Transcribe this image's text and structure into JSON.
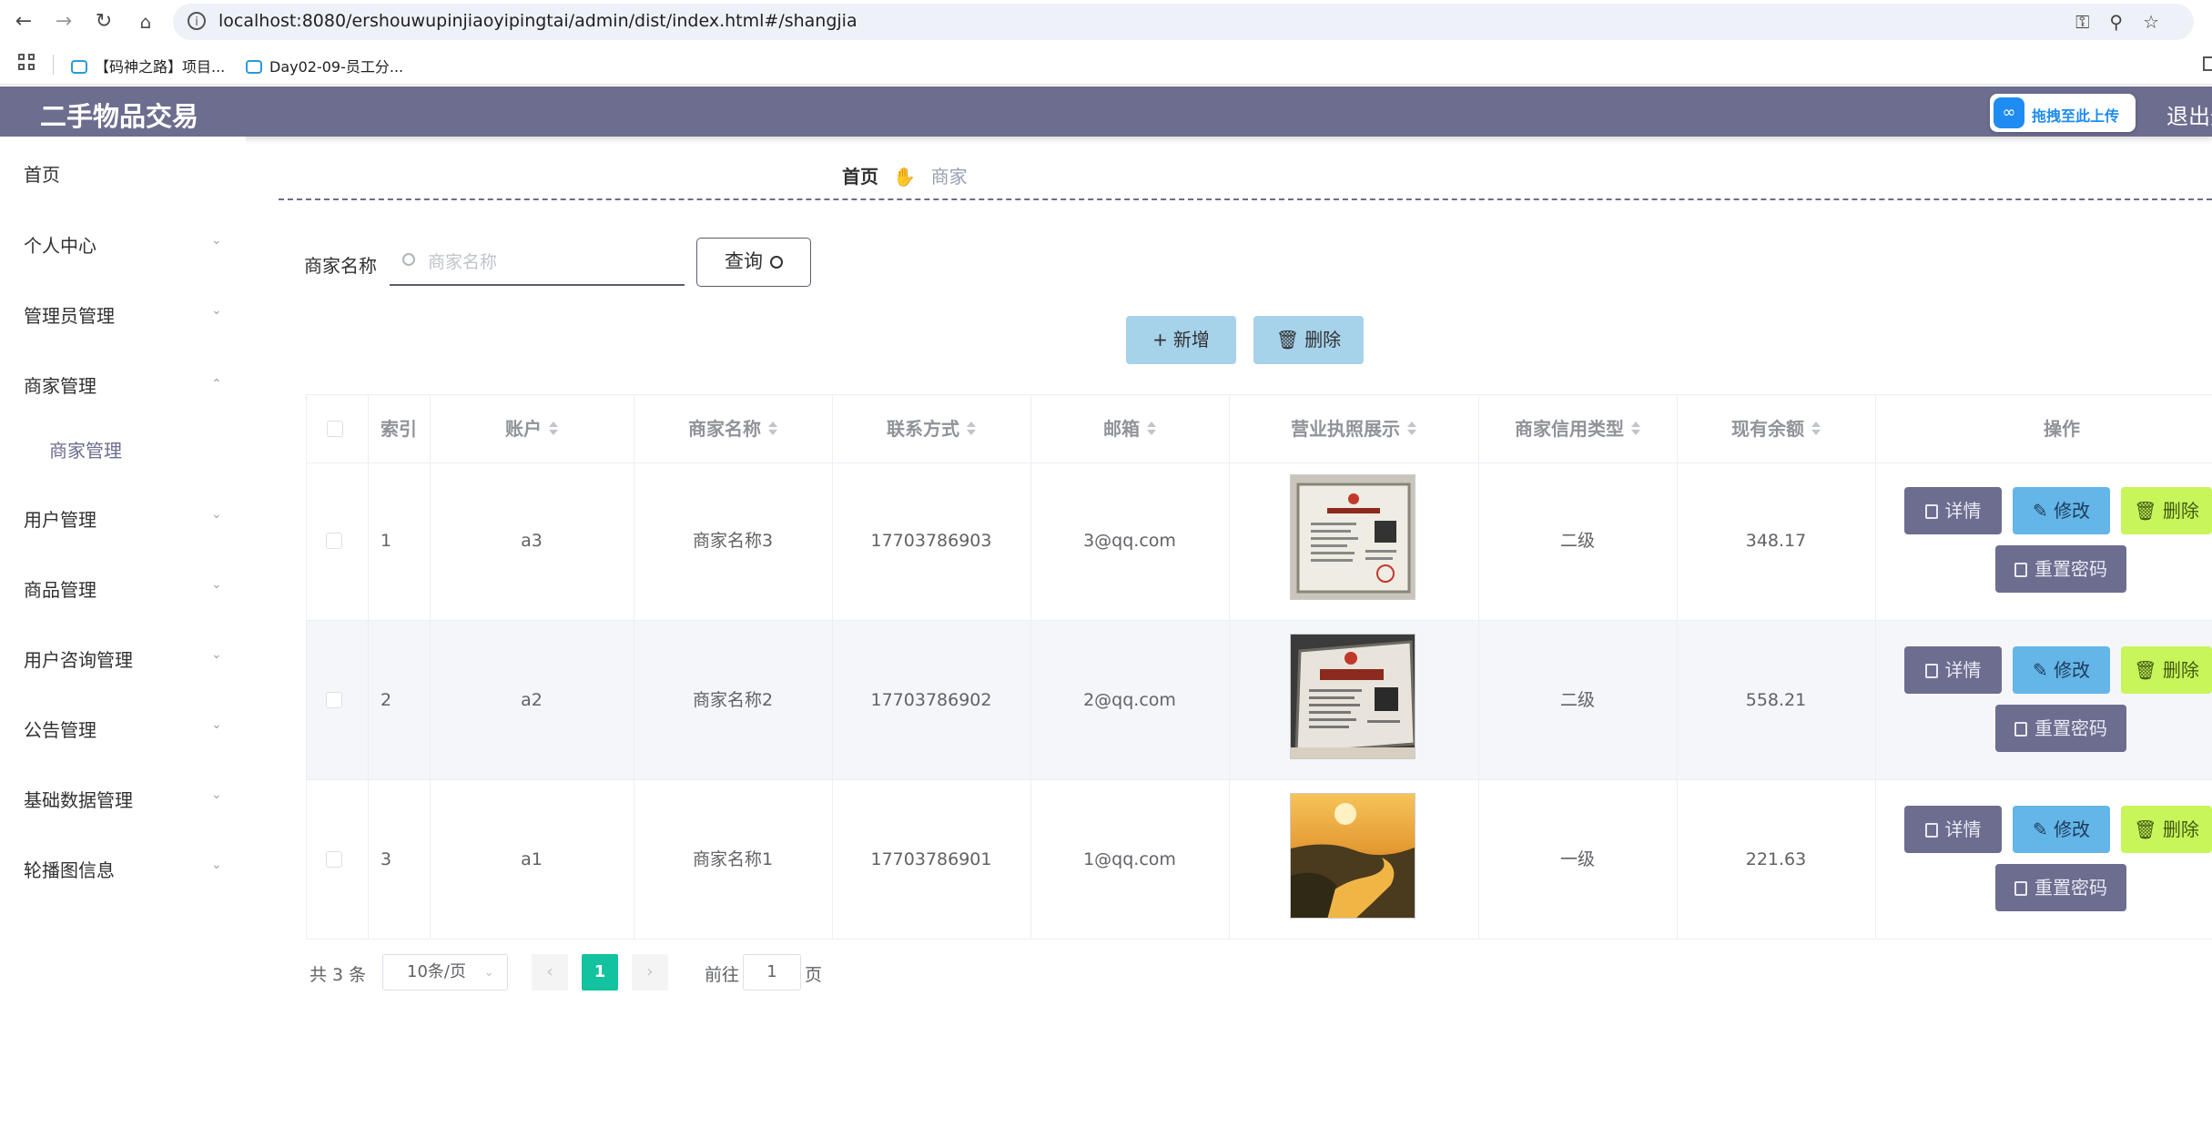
{
  "browser": {
    "url": "localhost:8080/ershouwupinjiaoyipingtai/admin/dist/index.html#/shangjia",
    "bookmarks": [
      "【码神之路】项目...",
      "Day02-09-员工分..."
    ]
  },
  "header": {
    "title": "二手物品交易",
    "upload_label": "拖拽至此上传",
    "logout_label": "退出登"
  },
  "sidebar": {
    "items": [
      {
        "label": "首页"
      },
      {
        "label": "个人中心"
      },
      {
        "label": "管理员管理"
      },
      {
        "label": "商家管理"
      },
      {
        "label": "用户管理"
      },
      {
        "label": "商品管理"
      },
      {
        "label": "用户咨询管理"
      },
      {
        "label": "公告管理"
      },
      {
        "label": "基础数据管理"
      },
      {
        "label": "轮播图信息"
      }
    ],
    "sub_item": "商家管理"
  },
  "breadcrumb": {
    "home": "首页",
    "current": "商家"
  },
  "search": {
    "label": "商家名称",
    "placeholder": "商家名称",
    "button": "查询"
  },
  "toolbar": {
    "add": "新增",
    "delete": "删除"
  },
  "table": {
    "headers": [
      "索引",
      "账户",
      "商家名称",
      "联系方式",
      "邮箱",
      "营业执照展示",
      "商家信用类型",
      "现有余额",
      "操作"
    ],
    "rows": [
      {
        "index": "1",
        "account": "a3",
        "name": "商家名称3",
        "phone": "17703786903",
        "email": "3@qq.com",
        "credit": "二级",
        "balance": "348.17"
      },
      {
        "index": "2",
        "account": "a2",
        "name": "商家名称2",
        "phone": "17703786902",
        "email": "2@qq.com",
        "credit": "二级",
        "balance": "558.21"
      },
      {
        "index": "3",
        "account": "a1",
        "name": "商家名称1",
        "phone": "17703786901",
        "email": "1@qq.com",
        "credit": "一级",
        "balance": "221.63"
      }
    ],
    "actions": {
      "detail": "详情",
      "edit": "修改",
      "delete": "删除",
      "reset": "重置密码"
    }
  },
  "pagination": {
    "total": "共 3 条",
    "page_size": "10条/页",
    "current": "1",
    "goto": "前往",
    "goto_value": "1",
    "page_unit": "页"
  },
  "colors": {
    "header_bg": "#6c6d8f",
    "tool_btn": "#a6d2ea",
    "edit_btn": "#64b5e8",
    "delete_btn": "#c8f55a",
    "active_page": "#13c29e"
  }
}
